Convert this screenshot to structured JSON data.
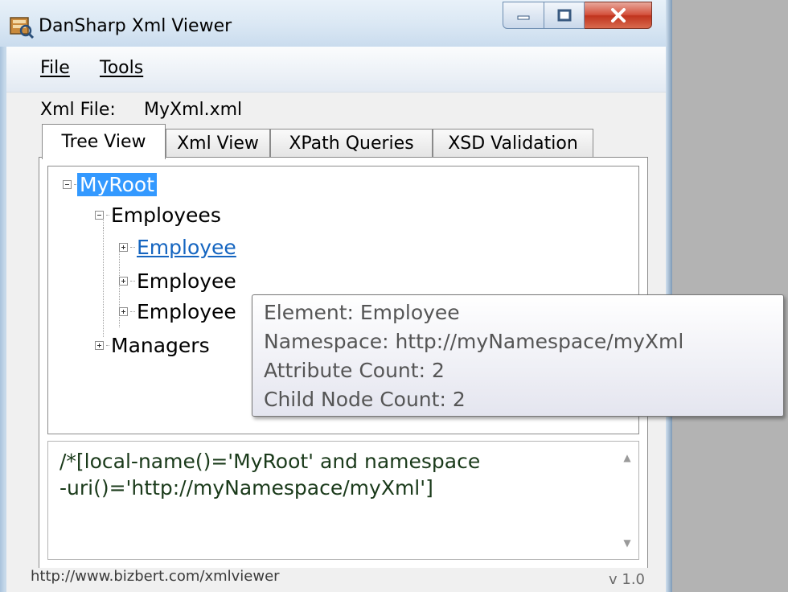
{
  "window": {
    "title": "DanSharp Xml Viewer",
    "accent_color": "#3399ff",
    "close_button_color": "#c0331d"
  },
  "menu": {
    "file": "File",
    "tools": "Tools"
  },
  "xml_file": {
    "label": "Xml File:",
    "value": "MyXml.xml"
  },
  "tabs": [
    {
      "label": "Tree View",
      "active": true
    },
    {
      "label": "Xml View",
      "active": false
    },
    {
      "label": "XPath Queries",
      "active": false
    },
    {
      "label": "XSD Validation",
      "active": false
    }
  ],
  "tree": {
    "root": "MyRoot",
    "employees": "Employees",
    "employee_1": "Employee",
    "employee_2": "Employee",
    "employee_3": "Employee",
    "managers": "Managers"
  },
  "tooltip": {
    "element": "Element: Employee",
    "namespace": "Namespace: http://myNamespace/myXml",
    "attribute_count": "Attribute Count: 2",
    "child_count": "Child Node Count: 2"
  },
  "query": {
    "text": "/*[local-name()='MyRoot' and namespace\n-uri()='http://myNamespace/myXml']"
  },
  "status": {
    "url": "http://www.bizbert.com/xmlviewer",
    "version": "v 1.0"
  },
  "icons": [
    "app-icon",
    "minimize-icon",
    "maximize-icon",
    "close-icon",
    "collapse-icon",
    "expand-icon",
    "scroll-up-icon",
    "scroll-down-icon"
  ]
}
